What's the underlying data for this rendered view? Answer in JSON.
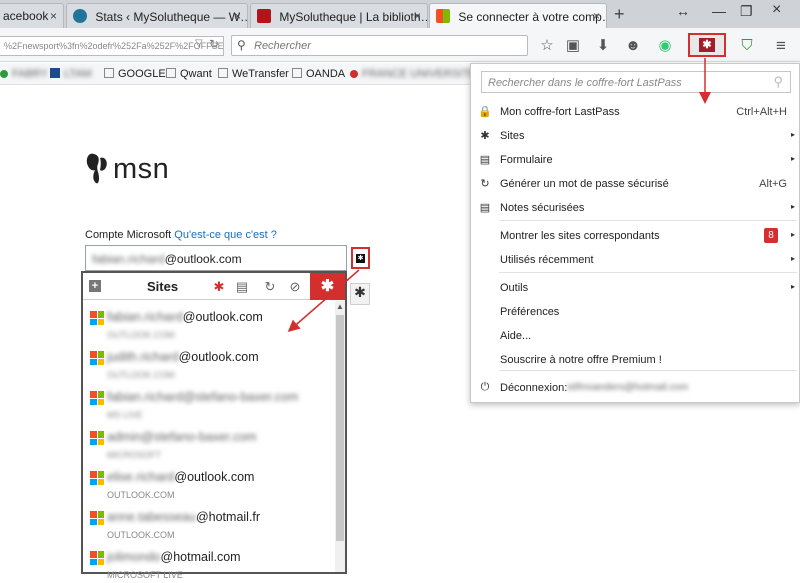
{
  "tabs": [
    {
      "label": "acebook",
      "close": "×"
    },
    {
      "label": "Stats ‹ MySolutheque — W…",
      "close": "×"
    },
    {
      "label": "MySolutheque | La biblioth…",
      "close": "×"
    },
    {
      "label": "Se connecter à votre comp…",
      "close": "×"
    }
  ],
  "new_tab": "+",
  "window": {
    "restore": "↔",
    "minimize": "—",
    "maximize": "❐",
    "close": "×"
  },
  "urlbar": {
    "value": "%2Fnewsport%3fn%2odefr%252Fa%252F%2FOFFSE"
  },
  "searchbar": {
    "placeholder": "Rechercher"
  },
  "bookmarks": [
    {
      "label": "FABRY",
      "blurred": true
    },
    {
      "label": "LTAM",
      "blurred": true
    },
    {
      "label": "GOOGLE",
      "blurred": false
    },
    {
      "label": "Qwant",
      "blurred": false
    },
    {
      "label": "WeTransfer",
      "blurred": false
    },
    {
      "label": "OANDA",
      "blurred": false
    },
    {
      "label": "FRANCE UNIVERSITE",
      "blurred": true
    }
  ],
  "page": {
    "logo_text": "msn",
    "account_label": "Compte Microsoft",
    "account_link": "Qu'est-ce que c'est ?",
    "account_value_blurred": "fabian.richard",
    "account_value_domain": "@outlook.com"
  },
  "sites_panel": {
    "plus": "+",
    "title": "Sites",
    "tab_icons": [
      "✱",
      "▤",
      "↻",
      "⊘"
    ],
    "active_tab_icon": "✱",
    "items": [
      {
        "user_blurred": "fabian.richard",
        "user_domain": "@outlook.com",
        "sub": "OUTLOOK.COM",
        "sub_blurred": true
      },
      {
        "user_blurred": "judith.richard",
        "user_domain": "@outlook.com",
        "sub": "OUTLOOK.COM",
        "sub_blurred": true
      },
      {
        "user_blurred": "fabian.richard@stefano-baxer.com",
        "user_domain": "",
        "sub": "MS LIVE",
        "sub_blurred": true
      },
      {
        "user_blurred": "admin@stefano-baxer.com",
        "user_domain": "",
        "sub": "MICROSOFT",
        "sub_blurred": true
      },
      {
        "user_blurred": "elise.richard",
        "user_domain": "@outlook.com",
        "sub": "OUTLOOK.COM",
        "sub_blurred": false
      },
      {
        "user_blurred": "anne.tabesseau",
        "user_domain": "@hotmail.fr",
        "sub": "OUTLOOK.COM",
        "sub_blurred": false
      },
      {
        "user_blurred": "jolimondo",
        "user_domain": "@hotmail.com",
        "sub": "MICROSOFT LIVE",
        "sub_blurred": false
      }
    ]
  },
  "lastpass_menu": {
    "search_placeholder": "Rechercher dans le coffre-fort LastPass",
    "items": [
      {
        "icon": "🔒",
        "label": "Mon coffre-fort LastPass",
        "shortcut": "Ctrl+Alt+H",
        "arrow": ""
      },
      {
        "icon": "✱",
        "label": "Sites",
        "shortcut": "",
        "arrow": "▸"
      },
      {
        "icon": "▤",
        "label": "Formulaire",
        "shortcut": "",
        "arrow": "▸"
      },
      {
        "icon": "↻",
        "label": "Générer un mot de passe sécurisé",
        "shortcut": "Alt+G",
        "arrow": ""
      },
      {
        "icon": "▤",
        "label": "Notes sécurisées",
        "shortcut": "",
        "arrow": "▸"
      },
      {
        "icon": "",
        "label": "Montrer les sites correspondants",
        "badge": "8",
        "arrow": "▸"
      },
      {
        "icon": "",
        "label": "Utilisés récemment",
        "shortcut": "",
        "arrow": "▸"
      },
      {
        "icon": "",
        "label": "Outils",
        "shortcut": "",
        "arrow": "▸"
      },
      {
        "icon": "",
        "label": "Préférences",
        "shortcut": "",
        "arrow": ""
      },
      {
        "icon": "",
        "label": "Aide...",
        "shortcut": "",
        "arrow": ""
      },
      {
        "icon": "",
        "label": "Souscrire à notre offre Premium !",
        "shortcut": "",
        "arrow": ""
      },
      {
        "icon": "⏻",
        "label": "Déconnexion:",
        "shortcut": "",
        "arrow": ""
      }
    ],
    "logout_email_blurred": "stifmoanders@hotmail.com"
  },
  "colors": {
    "lastpass_red": "#d32f2f",
    "lastpass_dark_red": "#a21c2a",
    "ms_red": "#f25022",
    "ms_green": "#7fba00",
    "ms_blue": "#00a4ef",
    "ms_yellow": "#ffb900",
    "link_blue": "#1a6dc2"
  }
}
